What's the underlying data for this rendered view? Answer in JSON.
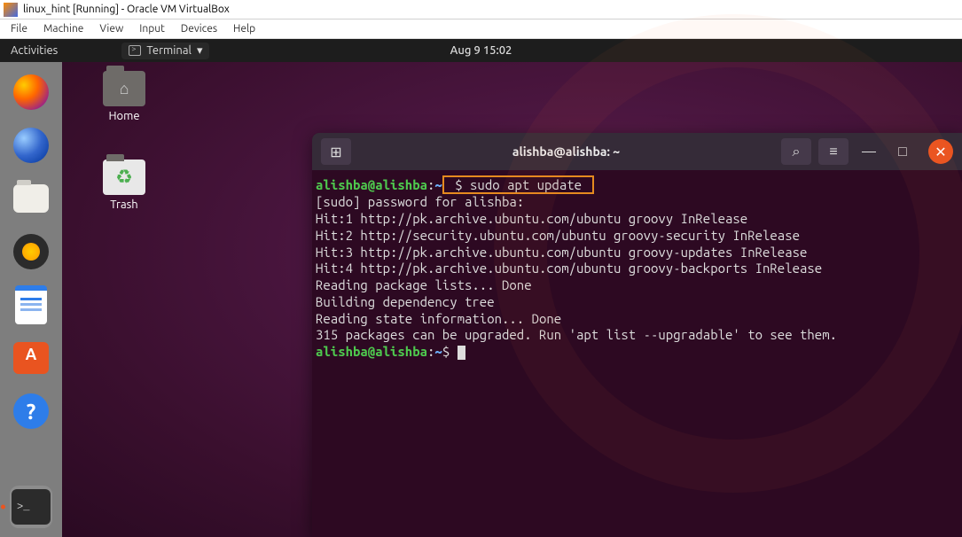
{
  "virtualbox": {
    "title": "linux_hint [Running] - Oracle VM VirtualBox",
    "menu": {
      "file": "File",
      "machine": "Machine",
      "view": "View",
      "input": "Input",
      "devices": "Devices",
      "help": "Help"
    }
  },
  "topbar": {
    "activities": "Activities",
    "app_label": "Terminal",
    "chevron": "▾",
    "datetime": "Aug 9  15:02"
  },
  "dock": {
    "items": [
      "firefox",
      "thunderbird",
      "files",
      "rhythmbox",
      "writer",
      "software",
      "help",
      "terminal"
    ]
  },
  "desktop": {
    "icons": {
      "home": "Home",
      "trash": "Trash"
    }
  },
  "terminal_window": {
    "title": "alishba@alishba: ~",
    "newtab_glyph": "⊞",
    "search_glyph": "⌕",
    "menu_glyph": "≡",
    "min_glyph": "—",
    "max_glyph": "□",
    "close_glyph": "✕"
  },
  "terminal": {
    "prompt_user": "alishba@alishba",
    "prompt_sep": ":",
    "prompt_path": "~",
    "prompt_dollar": "$",
    "highlight_cmd": " $ sudo apt update ",
    "lines": {
      "l1": "[sudo] password for alishba:",
      "l2": "Hit:1 http://pk.archive.ubuntu.com/ubuntu groovy InRelease",
      "l3": "Hit:2 http://security.ubuntu.com/ubuntu groovy-security InRelease",
      "l4": "Hit:3 http://pk.archive.ubuntu.com/ubuntu groovy-updates InRelease",
      "l5": "Hit:4 http://pk.archive.ubuntu.com/ubuntu groovy-backports InRelease",
      "l6": "Reading package lists... Done",
      "l7": "Building dependency tree",
      "l8": "Reading state information... Done",
      "l9": "315 packages can be upgraded. Run 'apt list --upgradable' to see them."
    }
  }
}
